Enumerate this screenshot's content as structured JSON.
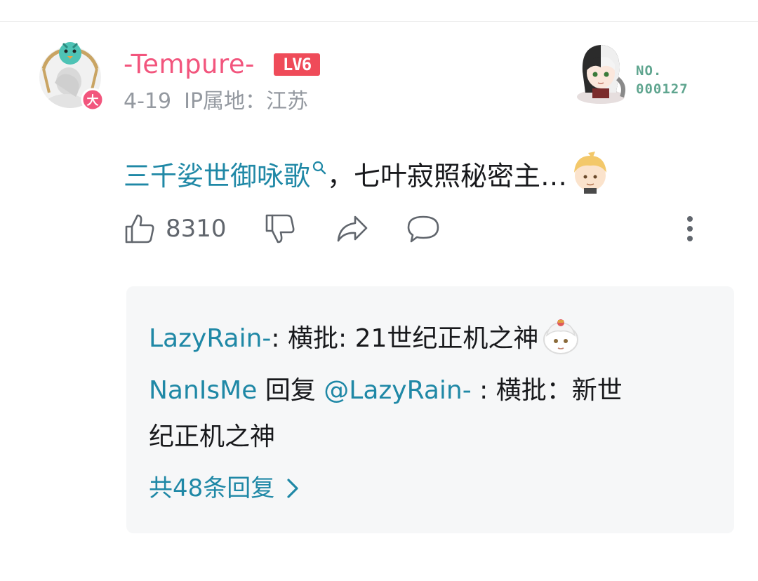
{
  "comment": {
    "username": "-Tempure-",
    "level": "LV6",
    "avatar_badge": "大",
    "date": "4-19",
    "ip_location": "IP属地：江苏",
    "fan_label": "NO.",
    "fan_number": "000127",
    "topic": "三千娑世御咏歌",
    "content_rest": "，七叶寂照秘密主…",
    "like_count": "8310"
  },
  "replies": [
    {
      "user": "LazyRain-",
      "separator": ": ",
      "text": "横批: 21世纪正机之神"
    },
    {
      "user": "NanIsMe",
      "action": " 回复 ",
      "mention": "@LazyRain-",
      "separator": " : ",
      "text_line1": "横批：新世",
      "text_line2": "纪正机之神"
    }
  ],
  "more_replies": "共48条回复",
  "colors": {
    "username": "#f2557d",
    "level_badge": "#ef4b59",
    "link": "#1f88a6",
    "meta_gray": "#9499a0",
    "icon_gray": "#61666d",
    "reply_bg": "#f6f7f8"
  },
  "icons": [
    "avatar",
    "fan-avatar",
    "search-icon",
    "sticker-icon",
    "thumbs-up-icon",
    "thumbs-down-icon",
    "share-icon",
    "comment-icon",
    "more-icon",
    "chevron-right-icon"
  ]
}
